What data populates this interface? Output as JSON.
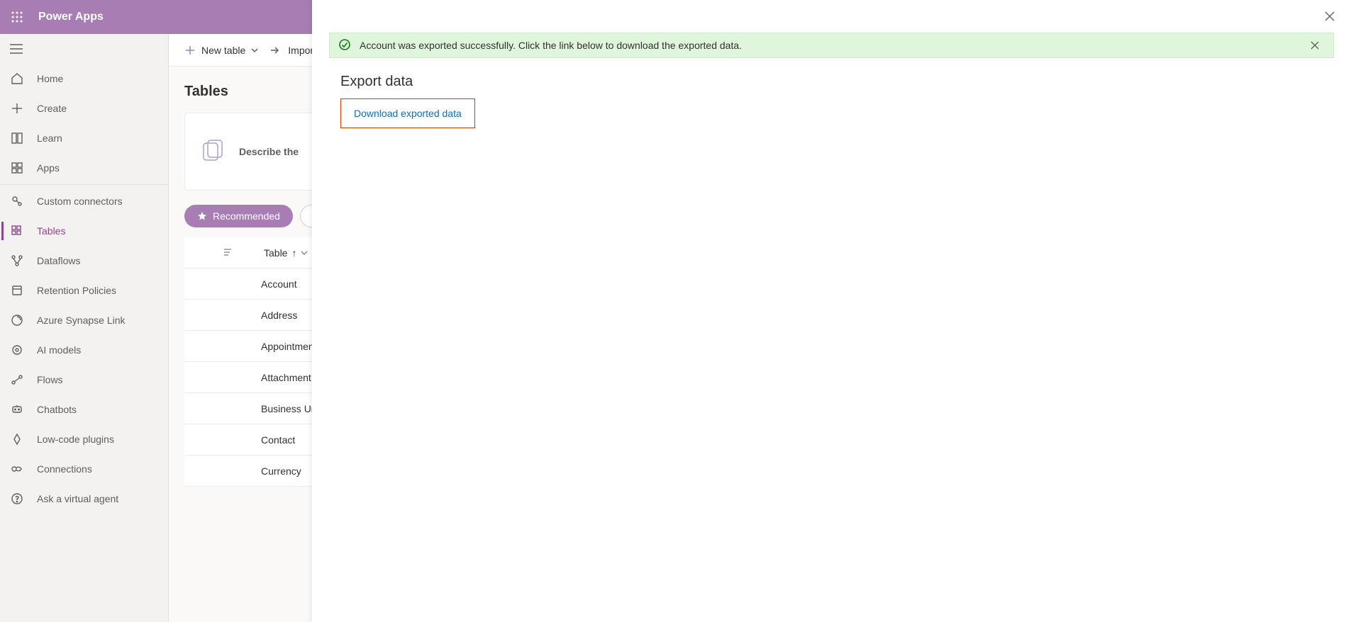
{
  "header": {
    "app_title": "Power Apps"
  },
  "nav": {
    "items": [
      {
        "label": "Home"
      },
      {
        "label": "Create"
      },
      {
        "label": "Learn"
      },
      {
        "label": "Apps"
      }
    ],
    "items2": [
      {
        "label": "Custom connectors"
      },
      {
        "label": "Tables"
      },
      {
        "label": "Dataflows"
      },
      {
        "label": "Retention Policies"
      },
      {
        "label": "Azure Synapse Link"
      },
      {
        "label": "AI models"
      },
      {
        "label": "Flows"
      },
      {
        "label": "Chatbots"
      },
      {
        "label": "Low-code plugins"
      },
      {
        "label": "Connections"
      },
      {
        "label": "Ask a virtual agent"
      }
    ]
  },
  "commandbar": {
    "new_table": "New table",
    "import": "Import"
  },
  "page": {
    "heading": "Tables",
    "describe_prompt": "Describe the"
  },
  "filter": {
    "recommended": "Recommended"
  },
  "table": {
    "col_table": "Table",
    "sort_arrow": "↑",
    "rows": [
      "Account",
      "Address",
      "Appointment",
      "Attachment",
      "Business Unit",
      "Contact",
      "Currency"
    ]
  },
  "flyout": {
    "banner_text": "Account was exported successfully. Click the link below to download the exported data.",
    "title": "Export data",
    "download_link_label": "Download exported data"
  }
}
